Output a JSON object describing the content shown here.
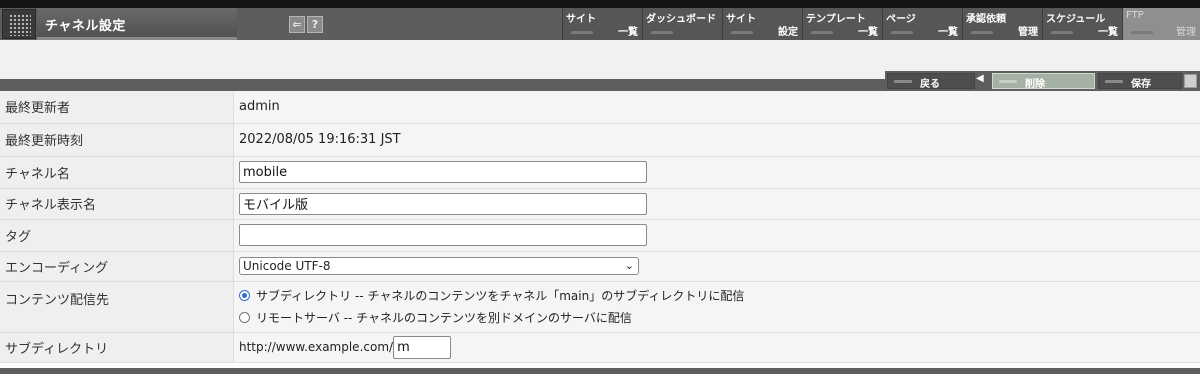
{
  "header": {
    "title": "チャネル設定",
    "back_icon": "back-arrow-icon",
    "help_icon": "help-icon",
    "help_glyph": "?",
    "nav": [
      {
        "top": "サイト",
        "bottom": "一覧"
      },
      {
        "top": "ダッシュボード",
        "bottom": ""
      },
      {
        "top": "サイト",
        "bottom": "設定"
      },
      {
        "top": "テンプレート",
        "bottom": "一覧"
      },
      {
        "top": "ページ",
        "bottom": "一覧"
      },
      {
        "top": "承認依頼",
        "bottom": "管理"
      },
      {
        "top": "スケジュール",
        "bottom": "一覧"
      },
      {
        "top": "FTP",
        "bottom": "管理"
      }
    ]
  },
  "actions": {
    "back": "戻る",
    "delete": "削除",
    "save": "保存"
  },
  "form": {
    "last_updated_by_label": "最終更新者",
    "last_updated_by_value": "admin",
    "last_updated_at_label": "最終更新時刻",
    "last_updated_at_value": "2022/08/05 19:16:31 JST",
    "channel_name_label": "チャネル名",
    "channel_name_value": "mobile",
    "channel_display_label": "チャネル表示名",
    "channel_display_value": "モバイル版",
    "tag_label": "タグ",
    "tag_value": "",
    "encoding_label": "エンコーディング",
    "encoding_value": "Unicode UTF-8",
    "delivery_label": "コンテンツ配信先",
    "delivery_option_1": "サブディレクトリ -- チャネルのコンテンツをチャネル「main」のサブディレクトリに配信",
    "delivery_option_2": "リモートサーバ -- チャネルのコンテンツを別ドメインのサーバに配信",
    "subdir_label": "サブディレクトリ",
    "subdir_prefix": "http://www.example.com/",
    "subdir_value": "m"
  }
}
